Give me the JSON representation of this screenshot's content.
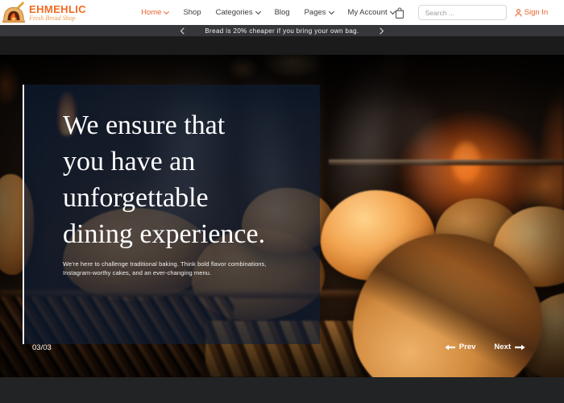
{
  "header": {
    "logo": {
      "title": "EHMEHLIC",
      "tagline": "Fresh Bread Shop"
    },
    "nav": [
      {
        "label": "Home"
      },
      {
        "label": "Shop"
      },
      {
        "label": "Categories"
      },
      {
        "label": "Blog"
      },
      {
        "label": "Pages"
      },
      {
        "label": "My Account"
      }
    ],
    "search": {
      "placeholder": "Search ..."
    },
    "sign_in_label": "Sign In"
  },
  "announcement": {
    "text": "Bread is 20% cheaper if you bring your own bag."
  },
  "hero": {
    "heading": "We ensure that you have an unforgettable dining experience.",
    "subtext": "We're here to challenge traditional baking. Think bold flavor combinations, Instagram-worthy cakes, and an ever-changing menu.",
    "slide_indicator": "03/03",
    "prev_label": "Prev",
    "next_label": "Next"
  },
  "colors": {
    "accent_orange": "#e8632c",
    "logo_orange": "#f26b21",
    "announcement_bg": "#35373a",
    "page_dark": "#1b1b1b",
    "caption_overlay": "rgba(13,31,58,0.60)"
  }
}
